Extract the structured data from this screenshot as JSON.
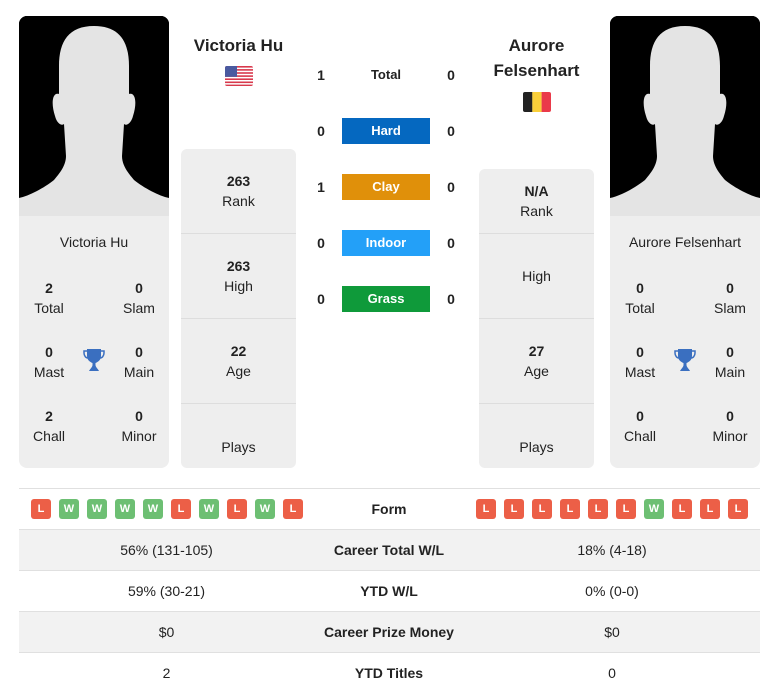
{
  "colors": {
    "hard": "#0568c0",
    "clay": "#e0900a",
    "indoor": "#23a0f8",
    "grass": "#0f9a3a",
    "loss": "#ec5f47",
    "win": "#6dbf73",
    "trophy": "#3a6fc0"
  },
  "player1": {
    "name": "Victoria Hu",
    "flag_icon": "us-flag-icon",
    "card_name": "Victoria Hu",
    "titles": {
      "total": {
        "value": "2",
        "label": "Total"
      },
      "slam": {
        "value": "0",
        "label": "Slam"
      },
      "mast": {
        "value": "0",
        "label": "Mast"
      },
      "main": {
        "value": "0",
        "label": "Main"
      },
      "chall": {
        "value": "2",
        "label": "Chall"
      },
      "minor": {
        "value": "0",
        "label": "Minor"
      }
    },
    "stats": {
      "rank": {
        "value": "263",
        "label": "Rank"
      },
      "high": {
        "value": "263",
        "label": "High"
      },
      "age": {
        "value": "22",
        "label": "Age"
      },
      "plays": {
        "value": "",
        "label": "Plays"
      }
    },
    "form": [
      "L",
      "W",
      "W",
      "W",
      "W",
      "L",
      "W",
      "L",
      "W",
      "L"
    ]
  },
  "player2": {
    "name_line1": "Aurore",
    "name_line2": "Felsenhart",
    "flag_icon": "belgium-flag-icon",
    "card_name": "Aurore Felsenhart",
    "titles": {
      "total": {
        "value": "0",
        "label": "Total"
      },
      "slam": {
        "value": "0",
        "label": "Slam"
      },
      "mast": {
        "value": "0",
        "label": "Mast"
      },
      "main": {
        "value": "0",
        "label": "Main"
      },
      "chall": {
        "value": "0",
        "label": "Chall"
      },
      "minor": {
        "value": "0",
        "label": "Minor"
      }
    },
    "stats": {
      "rank": {
        "value": "N/A",
        "label": "Rank"
      },
      "high": {
        "value": "",
        "label": "High"
      },
      "age": {
        "value": "27",
        "label": "Age"
      },
      "plays": {
        "value": "",
        "label": "Plays"
      }
    },
    "form": [
      "L",
      "L",
      "L",
      "L",
      "L",
      "L",
      "W",
      "L",
      "L",
      "L"
    ]
  },
  "h2h": [
    {
      "label": "Total",
      "p1": "1",
      "p2": "0",
      "surface": "total"
    },
    {
      "label": "Hard",
      "p1": "0",
      "p2": "0",
      "surface": "hard"
    },
    {
      "label": "Clay",
      "p1": "1",
      "p2": "0",
      "surface": "clay"
    },
    {
      "label": "Indoor",
      "p1": "0",
      "p2": "0",
      "surface": "indoor"
    },
    {
      "label": "Grass",
      "p1": "0",
      "p2": "0",
      "surface": "grass"
    }
  ],
  "table": {
    "form_label": "Form",
    "rows": [
      {
        "label": "Career Total W/L",
        "p1": "56% (131-105)",
        "p2": "18% (4-18)"
      },
      {
        "label": "YTD W/L",
        "p1": "59% (30-21)",
        "p2": "0% (0-0)"
      },
      {
        "label": "Career Prize Money",
        "p1": "$0",
        "p2": "$0"
      },
      {
        "label": "YTD Titles",
        "p1": "2",
        "p2": "0"
      }
    ]
  }
}
